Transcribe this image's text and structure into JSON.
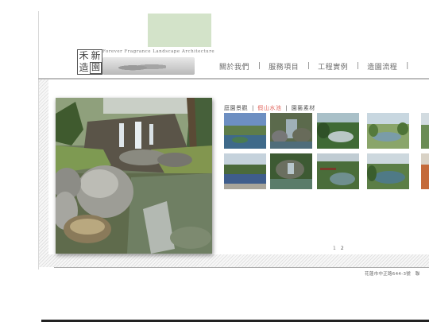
{
  "brand": {
    "chinese_name": [
      "禾",
      "新",
      "造",
      "園"
    ],
    "english_name": "Forever Fragrance Landscape Architecture"
  },
  "nav": {
    "items": [
      {
        "label": "關於我們"
      },
      {
        "label": "服務項目"
      },
      {
        "label": "工程實例"
      },
      {
        "label": "造園流程"
      }
    ],
    "separator": "|"
  },
  "gallery": {
    "tabs": [
      {
        "label": "庭園景觀",
        "active": false
      },
      {
        "label": "假山水池",
        "active": true
      },
      {
        "label": "園藝素材",
        "active": false
      }
    ],
    "separator": "|",
    "pages": [
      "1",
      "2"
    ]
  },
  "footer": {
    "address": "花蓮市中正路644-3號　聯"
  },
  "colors": {
    "active_tab": "#e0625a",
    "nav_text": "#6a6a6a",
    "accent_green": "#d3e3c9"
  }
}
